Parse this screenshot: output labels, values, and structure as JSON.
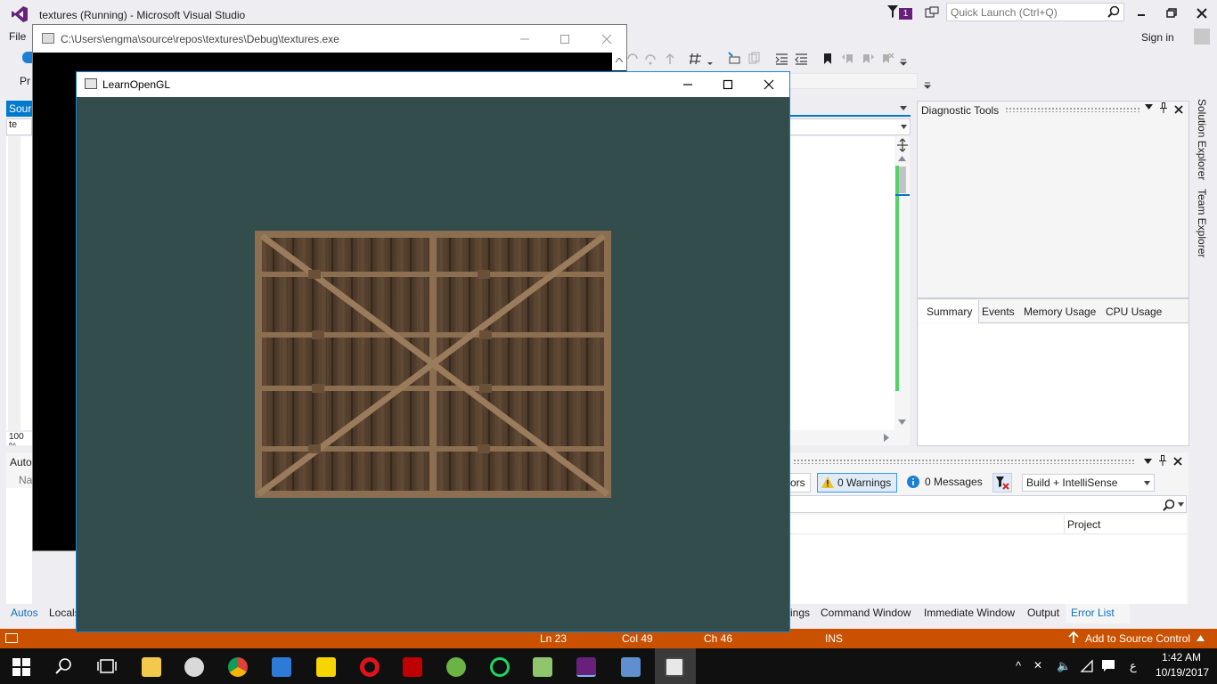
{
  "vs": {
    "window_title": "textures (Running) - Microsoft Visual Studio",
    "notification_count": "1",
    "quick_launch_placeholder": "Quick Launch (Ctrl+Q)",
    "menu_file": "File",
    "sign_in": "Sign in",
    "left_source_tab": "Sourc",
    "left_combo": "te",
    "left_zoom": "100 %",
    "left_autos_title": "Auto",
    "left_autos_col": "Na",
    "left_proc": "Pr",
    "left_bottom_tabs": [
      "Autos",
      "Locals"
    ]
  },
  "diagnostic_tools": {
    "title": "Diagnostic Tools",
    "tabs": [
      "Summary",
      "Events",
      "Memory Usage",
      "CPU Usage"
    ]
  },
  "side_tabs": [
    "Solution Explorer",
    "Team Explorer"
  ],
  "error_list": {
    "errors_label": "ors",
    "warnings_label": "0 Warnings",
    "messages_label": "0 Messages",
    "scope": "Build + IntelliSense",
    "column_project": "Project"
  },
  "bottom_tabs": [
    "ings",
    "Command Window",
    "Immediate Window",
    "Output",
    "Error List"
  ],
  "statusbar": {
    "ln": "Ln 23",
    "col": "Col 49",
    "ch": "Ch 46",
    "mode": "INS",
    "source_control": "Add to Source Control"
  },
  "console": {
    "title": "C:\\Users\\engma\\source\\repos\\textures\\Debug\\textures.exe"
  },
  "gl_window": {
    "title": "LearnOpenGL",
    "clear_color": "#334d4d"
  },
  "taskbar": {
    "time": "1:42 AM",
    "date": "10/19/2017",
    "ime": "ع",
    "apps": [
      "file-explorer",
      "opera-neon",
      "chrome",
      "media-player",
      "pdf-reader",
      "opera",
      "filezilla",
      "android-studio",
      "opera-gx",
      "notepad-plus",
      "visual-studio",
      "wordpad",
      "learnopengl-app"
    ]
  },
  "colors": {
    "accent": "#007acc",
    "statusbar": "#ca5100",
    "vs_purple": "#68217a"
  }
}
